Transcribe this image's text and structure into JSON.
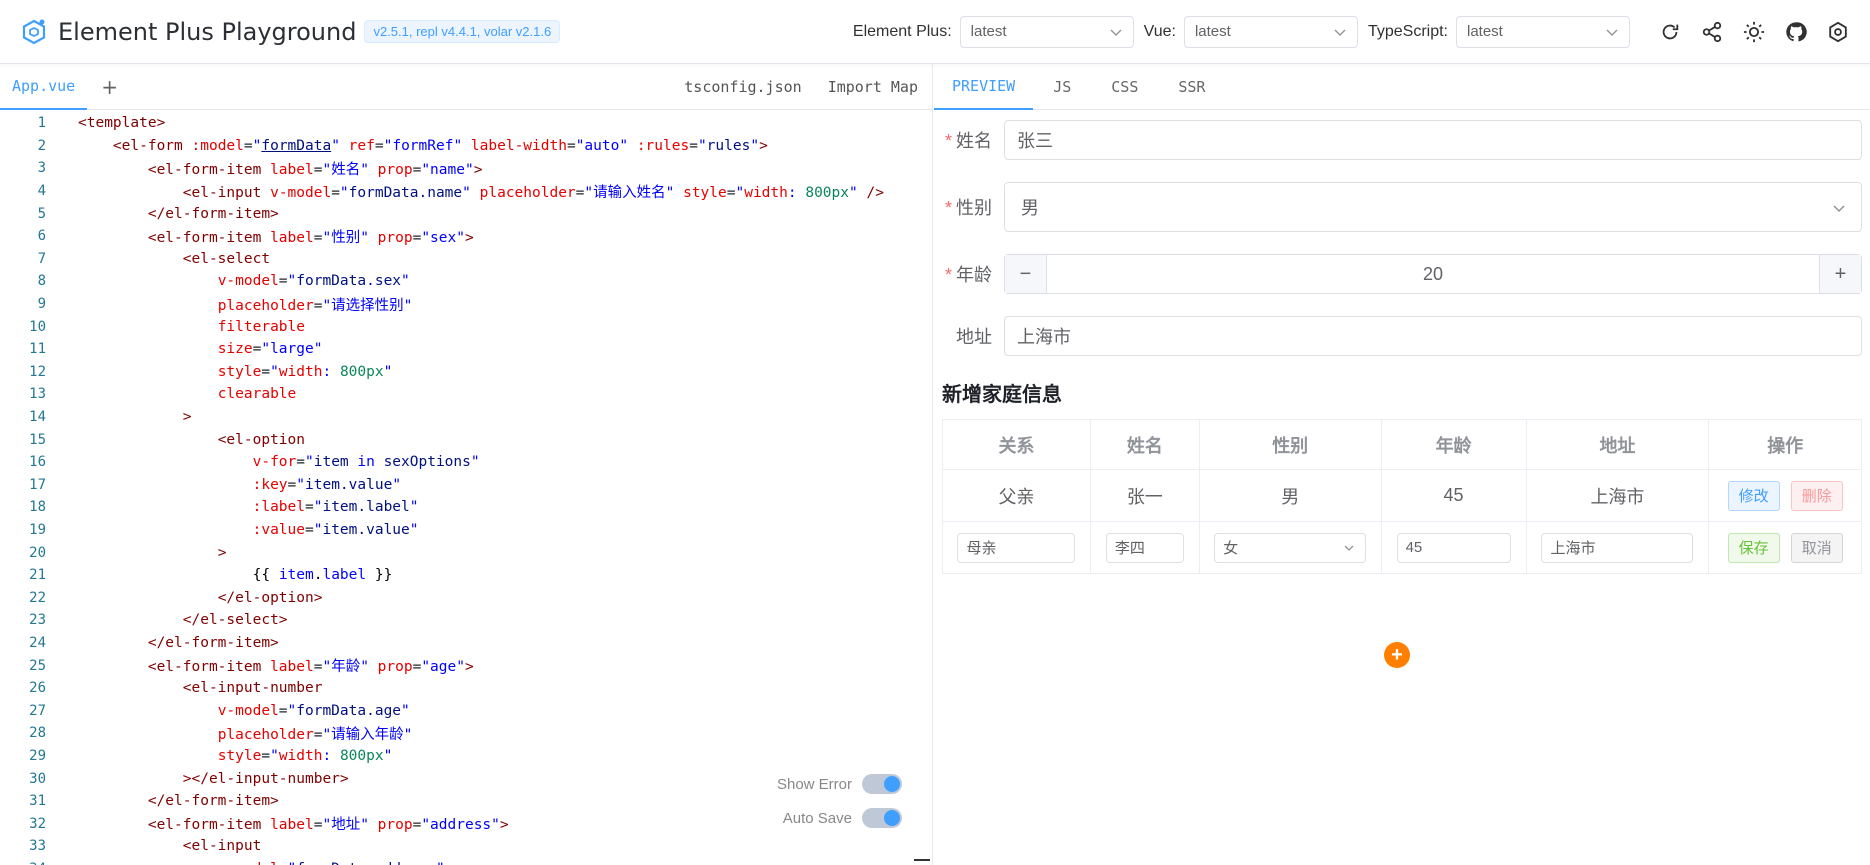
{
  "header": {
    "title": "Element Plus Playground",
    "version": "v2.5.1, repl v4.4.1, volar v2.1.6",
    "element_plus_label": "Element Plus:",
    "element_plus_value": "latest",
    "vue_label": "Vue:",
    "vue_value": "latest",
    "typescript_label": "TypeScript:",
    "typescript_value": "latest",
    "icons": [
      "refresh-icon",
      "share-icon",
      "sun-icon",
      "github-icon",
      "settings-icon"
    ]
  },
  "editor": {
    "active_file": "App.vue",
    "add_file": "+",
    "links": [
      "tsconfig.json",
      "Import Map"
    ],
    "show_error_label": "Show Error",
    "auto_save_label": "Auto Save"
  },
  "preview": {
    "tabs": [
      "PREVIEW",
      "JS",
      "CSS",
      "SSR"
    ],
    "form": {
      "name_label": "姓名",
      "name_value": "张三",
      "sex_label": "性别",
      "sex_value": "男",
      "age_label": "年龄",
      "age_value": "20",
      "address_label": "地址",
      "address_value": "上海市",
      "required_mark": "*",
      "minus": "−",
      "plus": "+"
    },
    "family": {
      "title": "新增家庭信息",
      "columns": [
        "关系",
        "姓名",
        "性别",
        "年龄",
        "地址",
        "操作"
      ],
      "row1": {
        "relation": "父亲",
        "name": "张一",
        "sex": "男",
        "age": "45",
        "address": "上海市",
        "edit": "修改",
        "delete": "删除"
      },
      "row2": {
        "relation": "母亲",
        "name": "李四",
        "sex": "女",
        "age": "45",
        "address": "上海市",
        "save": "保存",
        "cancel": "取消"
      },
      "add": "+"
    }
  },
  "colors": {
    "accent": "#409eff",
    "add_button": "#ff7f00",
    "required": "#f56c6c"
  }
}
